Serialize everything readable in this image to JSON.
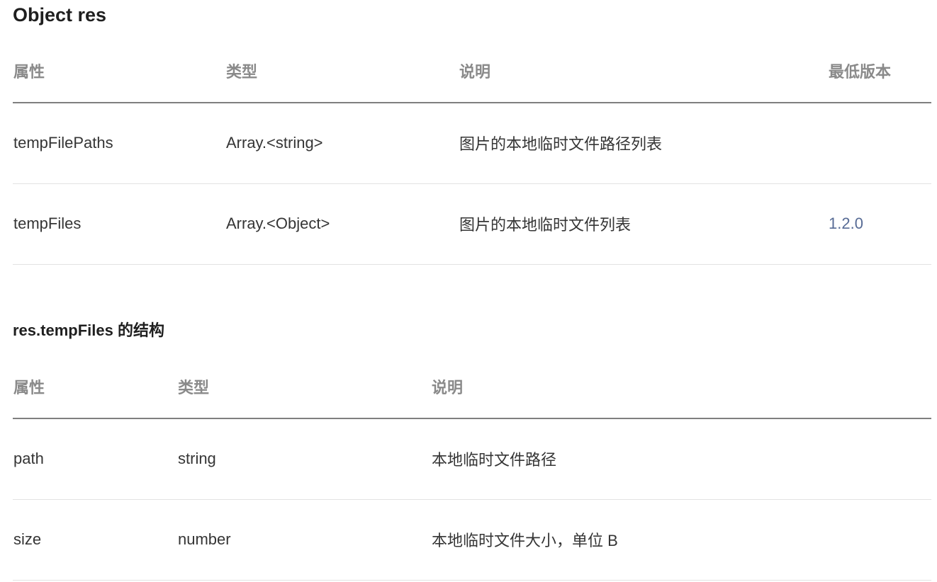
{
  "section_res": {
    "title": "Object res",
    "headers": [
      "属性",
      "类型",
      "说明",
      "最低版本"
    ],
    "rows": [
      {
        "property": "tempFilePaths",
        "type": "Array.<string>",
        "description": "图片的本地临时文件路径列表",
        "version": ""
      },
      {
        "property": "tempFiles",
        "type": "Array.<Object>",
        "description": "图片的本地临时文件列表",
        "version": "1.2.0"
      }
    ]
  },
  "section_tempfiles": {
    "title": "res.tempFiles 的结构",
    "headers": [
      "属性",
      "类型",
      "说明"
    ],
    "rows": [
      {
        "property": "path",
        "type": "string",
        "description": "本地临时文件路径"
      },
      {
        "property": "size",
        "type": "number",
        "description": "本地临时文件大小，单位 B"
      }
    ]
  },
  "colors": {
    "heading": "#1f1f1f",
    "header_text": "#8a8a8a",
    "body_text": "#353535",
    "link_version": "#576b95",
    "header_rule": "#7f7f7f",
    "row_rule": "#e2e2e2"
  }
}
